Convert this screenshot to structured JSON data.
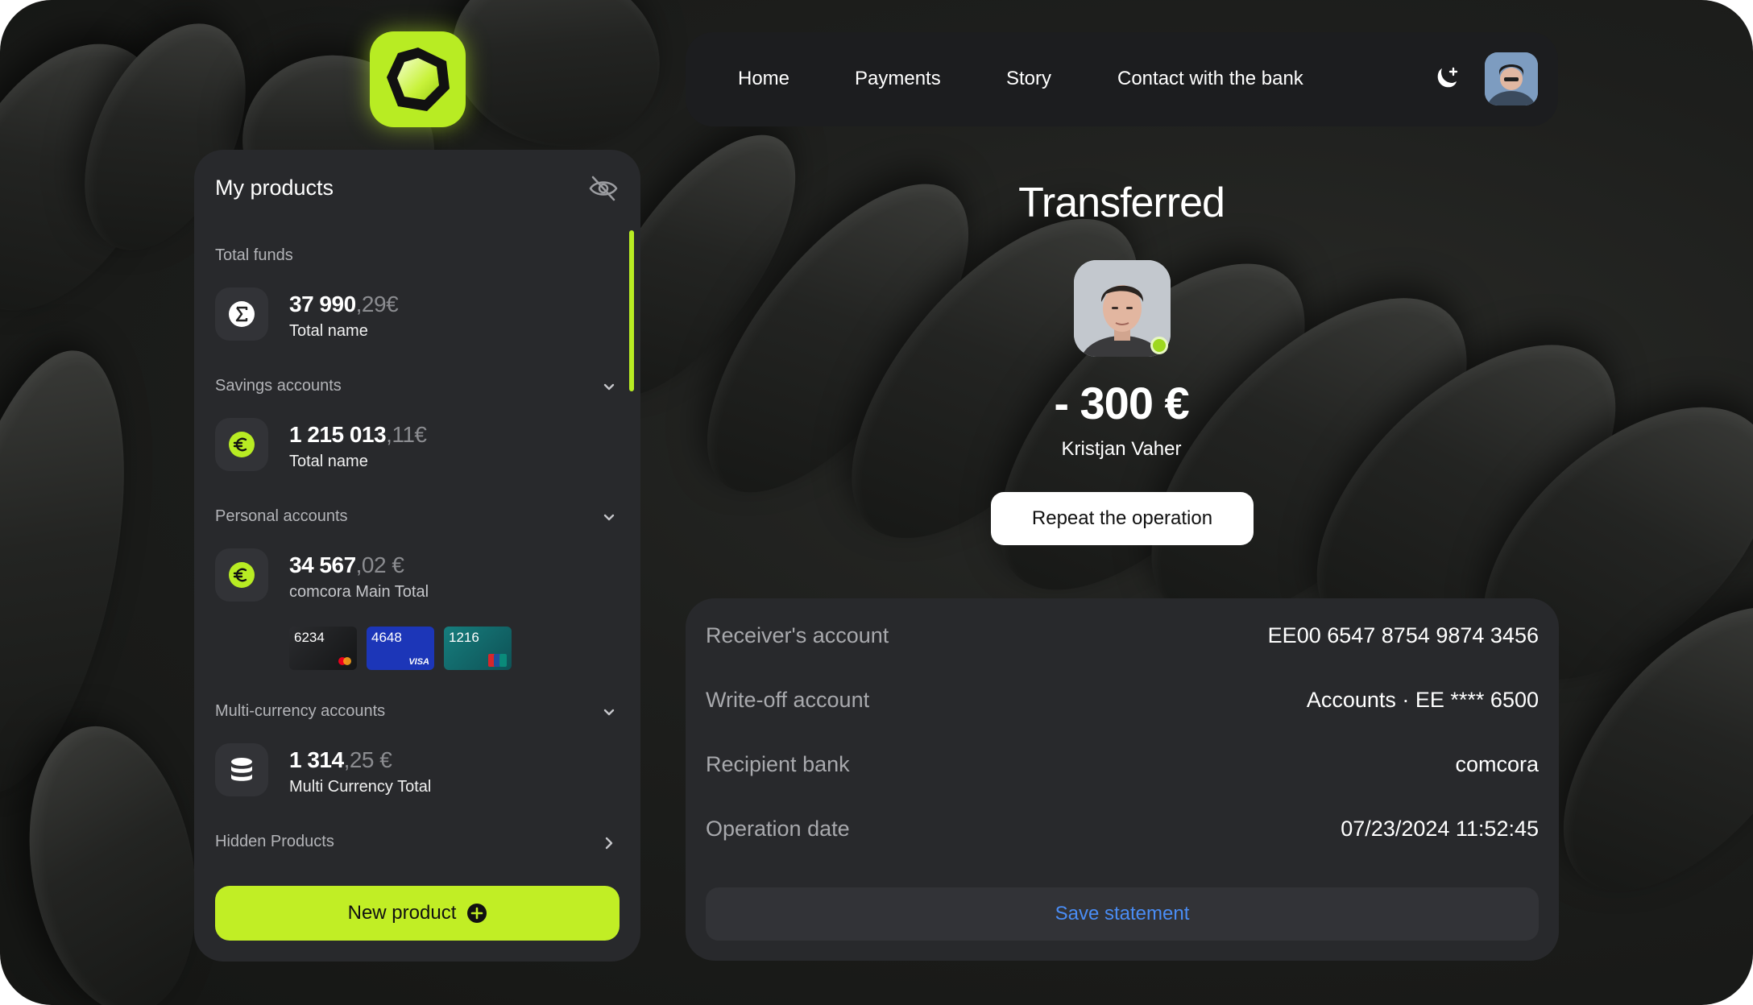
{
  "nav": {
    "items": [
      {
        "label": "Home"
      },
      {
        "label": "Payments"
      },
      {
        "label": "Story"
      },
      {
        "label": "Contact with the bank"
      }
    ]
  },
  "products": {
    "title": "My products",
    "sections": {
      "total": {
        "label": "Total funds",
        "amount_int": "37 990",
        "amount_dec": ",29€",
        "name": "Total name",
        "icon": "sigma-icon"
      },
      "savings": {
        "label": "Savings accounts",
        "amount_int": "1 215 013",
        "amount_dec": ",11€",
        "name": "Total name",
        "icon": "euro-icon"
      },
      "personal": {
        "label": "Personal accounts",
        "amount_int": "34 567",
        "amount_dec": ",02 €",
        "name": "comcora Main Total",
        "icon": "euro-icon",
        "cards": [
          {
            "number": "6234",
            "brand": "mastercard",
            "color": "#1e1f22"
          },
          {
            "number": "4648",
            "brand": "visa",
            "color": "#1c36b8"
          },
          {
            "number": "1216",
            "brand": "unionpay",
            "color": "#136a6c"
          }
        ]
      },
      "multi": {
        "label": "Multi-currency accounts",
        "amount_int": "1 314",
        "amount_dec": ",25 €",
        "name": "Multi Currency Total",
        "icon": "database-icon"
      },
      "hidden": {
        "label": "Hidden Products"
      }
    },
    "new_product_label": "New product"
  },
  "transfer": {
    "status": "Transferred",
    "amount": "- 300 €",
    "recipient": "Kristjan Vaher",
    "repeat_label": "Repeat the operation"
  },
  "details": {
    "rows": [
      {
        "label": "Receiver's account",
        "value": "EE00 6547 8754 9874 3456"
      },
      {
        "label": "Write-off account",
        "value": "Accounts · EE **** 6500"
      },
      {
        "label": "Recipient bank",
        "value": "comcora"
      },
      {
        "label": "Operation date",
        "value": "07/23/2024 11:52:45"
      }
    ],
    "save_label": "Save statement"
  },
  "colors": {
    "accent": "#b8ec23",
    "link": "#4a8df5",
    "panel": "#28292c"
  }
}
